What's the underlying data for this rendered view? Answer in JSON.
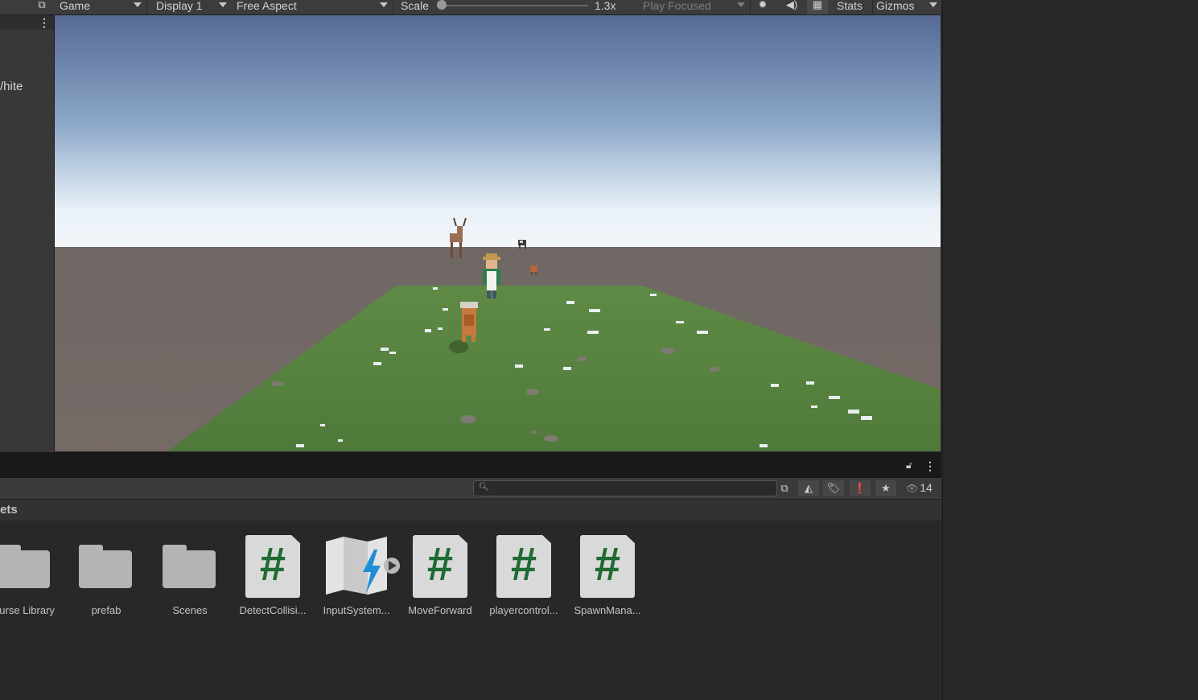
{
  "toolbar": {
    "view_tab": "Game",
    "display": "Display 1",
    "aspect": "Free Aspect",
    "scale_label": "Scale",
    "scale_value": "1.3x",
    "play_mode": "Play Focused",
    "stats": "Stats",
    "gizmos": "Gizmos"
  },
  "left_panel": {
    "partial_text": "/hite"
  },
  "project": {
    "breadcrumb": "ets",
    "visible_count": "14",
    "assets": [
      {
        "type": "folder",
        "label": "ourse Library"
      },
      {
        "type": "folder",
        "label": "prefab"
      },
      {
        "type": "folder",
        "label": "Scenes"
      },
      {
        "type": "script",
        "label": "DetectCollisi..."
      },
      {
        "type": "input-actions",
        "label": "InputSystem..."
      },
      {
        "type": "script",
        "label": "MoveForward"
      },
      {
        "type": "script",
        "label": "playercontrol..."
      },
      {
        "type": "script",
        "label": "SpawnMana..."
      }
    ]
  },
  "colors": {
    "script_hash": "#1f6b34",
    "folder": "#b4b4b4",
    "ground": "#567a3e"
  }
}
